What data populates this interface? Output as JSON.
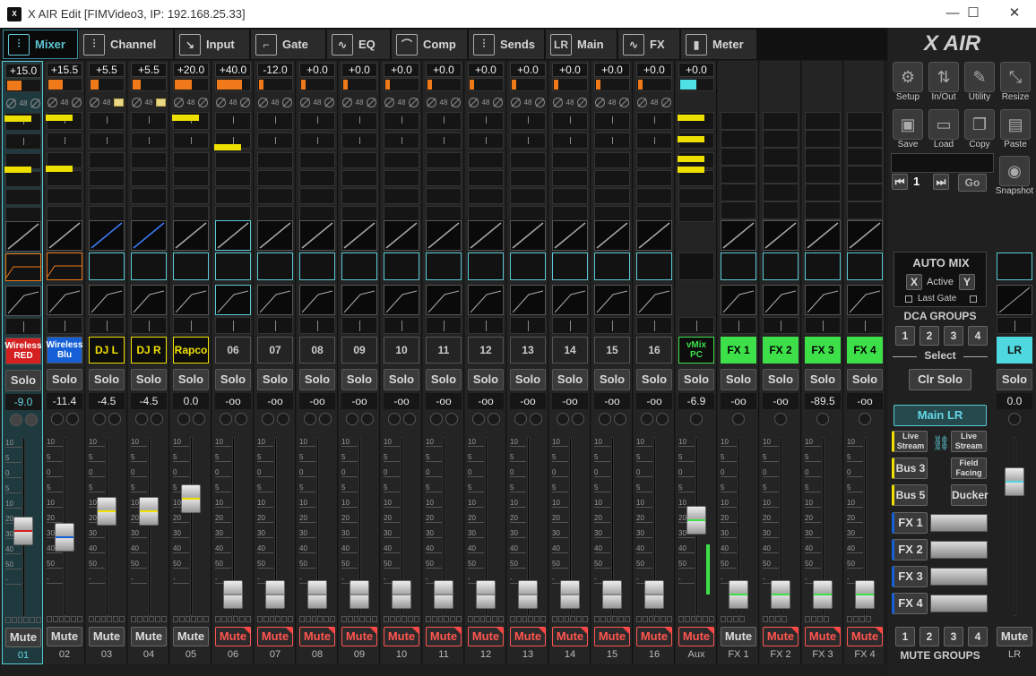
{
  "window": {
    "title": "X AIR Edit [FIMVideo3, IP: 192.168.25.33]",
    "icon": "X",
    "min": "—",
    "max": "☐",
    "close": "✕"
  },
  "tabs": [
    {
      "label": "Mixer",
      "icon": "mixer-icon",
      "glyph": "⫶",
      "active": true
    },
    {
      "label": "Channel",
      "icon": "channel-icon",
      "glyph": "⫶"
    },
    {
      "label": "Input",
      "icon": "input-icon",
      "glyph": "↘"
    },
    {
      "label": "Gate",
      "icon": "gate-icon",
      "glyph": "⌐"
    },
    {
      "label": "EQ",
      "icon": "eq-icon",
      "glyph": "∿"
    },
    {
      "label": "Comp",
      "icon": "comp-icon",
      "glyph": "⌒"
    },
    {
      "label": "Sends",
      "icon": "sends-icon",
      "glyph": "⫶"
    },
    {
      "label": "Main",
      "icon": "main-icon",
      "glyph": "LR"
    },
    {
      "label": "FX",
      "icon": "fx-icon",
      "glyph": "∿"
    },
    {
      "label": "Meter",
      "icon": "meter-icon",
      "glyph": "▮"
    }
  ],
  "strips": [
    {
      "gain": "+15.0",
      "name": "Wireless RED",
      "name_bg": "#d42020",
      "name_fg": "#ffffff",
      "level": "-9.0",
      "num": "01",
      "mute": "Mute",
      "solo": "Solo",
      "muted": false,
      "sel": true,
      "fader_pct": 0.55
    },
    {
      "gain": "+15.5",
      "name": "Wireless Blu",
      "name_bg": "#1560d6",
      "name_fg": "#ffffff",
      "level": "-11.4",
      "num": "02",
      "mute": "Mute",
      "solo": "Solo",
      "muted": false,
      "fader_pct": 0.6
    },
    {
      "gain": "+5.5",
      "name": "DJ L",
      "name_bg": "#0d0d0d",
      "name_fg": "#f0e000",
      "border": "#f0e000",
      "level": "-4.5",
      "num": "03",
      "mute": "Mute",
      "solo": "Solo",
      "muted": false,
      "fader_pct": 0.42
    },
    {
      "gain": "+5.5",
      "name": "DJ R",
      "name_bg": "#0d0d0d",
      "name_fg": "#f0e000",
      "border": "#f0e000",
      "level": "-4.5",
      "num": "04",
      "mute": "Mute",
      "solo": "Solo",
      "muted": false,
      "fader_pct": 0.42
    },
    {
      "gain": "+20.0",
      "name": "Rapco",
      "name_bg": "#0d0d0d",
      "name_fg": "#f0e000",
      "border": "#f0e000",
      "level": "0.0",
      "num": "05",
      "mute": "Mute",
      "solo": "Solo",
      "muted": false,
      "fader_pct": 0.33
    },
    {
      "gain": "+40.0",
      "name": "06",
      "level": "-oo",
      "num": "06",
      "mute": "Mute",
      "solo": "Solo",
      "muted": true,
      "fader_pct": 1
    },
    {
      "gain": "-12.0",
      "name": "07",
      "level": "-oo",
      "num": "07",
      "mute": "Mute",
      "solo": "Solo",
      "muted": true,
      "fader_pct": 1
    },
    {
      "gain": "+0.0",
      "name": "08",
      "level": "-oo",
      "num": "08",
      "mute": "Mute",
      "solo": "Solo",
      "muted": true,
      "fader_pct": 1
    },
    {
      "gain": "+0.0",
      "name": "09",
      "level": "-oo",
      "num": "09",
      "mute": "Mute",
      "solo": "Solo",
      "muted": true,
      "fader_pct": 1
    },
    {
      "gain": "+0.0",
      "name": "10",
      "level": "-oo",
      "num": "10",
      "mute": "Mute",
      "solo": "Solo",
      "muted": true,
      "fader_pct": 1
    },
    {
      "gain": "+0.0",
      "name": "11",
      "level": "-oo",
      "num": "11",
      "mute": "Mute",
      "solo": "Solo",
      "muted": true,
      "fader_pct": 1
    },
    {
      "gain": "+0.0",
      "name": "12",
      "level": "-oo",
      "num": "12",
      "mute": "Mute",
      "solo": "Solo",
      "muted": true,
      "fader_pct": 1
    },
    {
      "gain": "+0.0",
      "name": "13",
      "level": "-oo",
      "num": "13",
      "mute": "Mute",
      "solo": "Solo",
      "muted": true,
      "fader_pct": 1
    },
    {
      "gain": "+0.0",
      "name": "14",
      "level": "-oo",
      "num": "14",
      "mute": "Mute",
      "solo": "Solo",
      "muted": true,
      "fader_pct": 1
    },
    {
      "gain": "+0.0",
      "name": "15",
      "level": "-oo",
      "num": "15",
      "mute": "Mute",
      "solo": "Solo",
      "muted": true,
      "fader_pct": 1
    },
    {
      "gain": "+0.0",
      "name": "16",
      "level": "-oo",
      "num": "16",
      "mute": "Mute",
      "solo": "Solo",
      "muted": true,
      "fader_pct": 1
    },
    {
      "gain": "+0.0",
      "name": "vMix PC",
      "name_bg": "#0d0d0d",
      "name_fg": "#3ee04a",
      "border": "#3ee04a",
      "level": "-6.9",
      "num": "Aux",
      "mute": "Mute",
      "solo": "Solo",
      "muted": true,
      "fader_pct": 0.48,
      "aux": true
    },
    {
      "name": "FX 1",
      "name_bg": "#3ee04a",
      "name_fg": "#000000",
      "level": "-oo",
      "num": "FX 1",
      "mute": "Mute",
      "solo": "Solo",
      "muted": false,
      "fader_pct": 1,
      "fx": true
    },
    {
      "name": "FX 2",
      "name_bg": "#3ee04a",
      "name_fg": "#000000",
      "level": "-oo",
      "num": "FX 2",
      "mute": "Mute",
      "solo": "Solo",
      "muted": true,
      "fader_pct": 1,
      "fx": true
    },
    {
      "name": "FX 3",
      "name_bg": "#3ee04a",
      "name_fg": "#000000",
      "level": "-89.5",
      "num": "FX 3",
      "mute": "Mute",
      "solo": "Solo",
      "muted": true,
      "fader_pct": 1,
      "fx": true
    },
    {
      "name": "FX 4",
      "name_bg": "#3ee04a",
      "name_fg": "#000000",
      "level": "-oo",
      "num": "FX 4",
      "mute": "Mute",
      "solo": "Solo",
      "muted": true,
      "fader_pct": 1,
      "fx": true
    }
  ],
  "scale_ticks": [
    "10",
    "5",
    "0",
    "5",
    "10",
    "20",
    "30",
    "40",
    "50",
    "-"
  ],
  "phantom_label": "48",
  "right": {
    "logo": "X AIR",
    "buttons": [
      {
        "label": "Setup",
        "icon": "gear-icon",
        "glyph": "⚙"
      },
      {
        "label": "In/Out",
        "icon": "in-out-icon",
        "glyph": "⇅"
      },
      {
        "label": "Utility",
        "icon": "wrench-icon",
        "glyph": "✎"
      },
      {
        "label": "Resize",
        "icon": "resize-icon",
        "glyph": "⤡"
      },
      {
        "label": "Save",
        "icon": "save-icon",
        "glyph": "▣"
      },
      {
        "label": "Load",
        "icon": "folder-icon",
        "glyph": "▭"
      },
      {
        "label": "Copy",
        "icon": "copy-icon",
        "glyph": "❐"
      },
      {
        "label": "Paste",
        "icon": "paste-icon",
        "glyph": "▤"
      }
    ],
    "snapshot": {
      "label": "Snapshot",
      "number": "1",
      "go": "Go"
    },
    "automix": {
      "title": "AUTO MIX",
      "x": "X",
      "active": "Active",
      "y": "Y",
      "last_gate": "Last Gate"
    },
    "dca_title": "DCA GROUPS",
    "dca": [
      "1",
      "2",
      "3",
      "4"
    ],
    "select_label": "Select",
    "clr_solo": "Clr Solo",
    "main_lr": "Main LR",
    "buses": [
      {
        "left": "Live Stream",
        "right": "Live Stream"
      },
      {
        "left": "Bus 3",
        "right": "Field Facing"
      },
      {
        "left": "Bus 5",
        "right": "Ducker"
      }
    ],
    "fx": [
      "FX 1",
      "FX 2",
      "FX 3",
      "FX 4"
    ],
    "mute_groups": [
      "1",
      "2",
      "3",
      "4"
    ],
    "mute_groups_title": "MUTE GROUPS",
    "lr": {
      "name": "LR",
      "solo": "Solo",
      "level": "0.0",
      "mute": "Mute",
      "num": "LR"
    }
  }
}
